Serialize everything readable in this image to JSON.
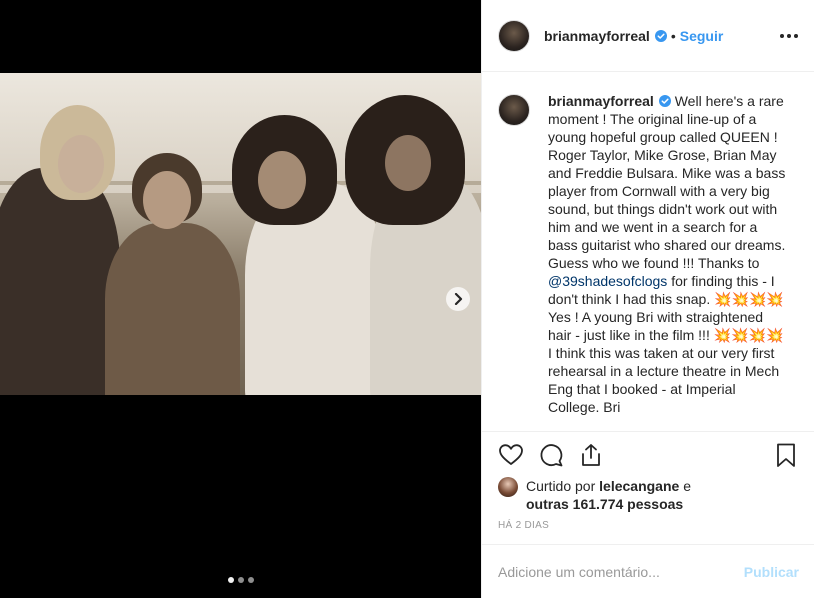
{
  "post": {
    "username": "brianmayforreal",
    "separator": "•",
    "follow_label": "Seguir",
    "caption_user": "brianmayforreal",
    "caption_part1": "Well here's a rare moment ! The original line-up of a young hopeful group called QUEEN ! Roger Taylor, Mike Grose, Brian May and Freddie Bulsara. Mike was a bass player from Cornwall with a very big sound, but things didn't work out with him and we went in a search for a bass guitarist who shared our dreams. Guess who we found !!! Thanks to",
    "mention": "@39shadesofclogs",
    "caption_part2": "for finding this - I don't think I had this snap.",
    "emoji_run_1": "💥💥💥💥",
    "caption_part3": "Yes ! A young Bri with straightened hair - just like in the film !!!",
    "emoji_run_2": "💥💥💥💥",
    "caption_part4": "I think this was taken at our very first rehearsal in a lecture theatre in Mech Eng that I booked - at Imperial College. Bri",
    "liked_prefix": "Curtido por",
    "liked_user": "lelecangane",
    "liked_and": "e",
    "liked_others": "outras 161.774 pessoas",
    "date": "HÁ 2 DIAS",
    "comment_placeholder": "Adicione um comentário...",
    "publish_label": "Publicar"
  },
  "carousel": {
    "count": 3,
    "active_index": 0
  },
  "icons": [
    "heart-icon",
    "comment-icon",
    "share-icon",
    "bookmark-icon",
    "verified-icon",
    "more-icon",
    "chevron-right-icon"
  ],
  "colors": {
    "accent": "#3897f0",
    "publish_disabled": "#b2dffc",
    "verified": "#3897f0"
  }
}
